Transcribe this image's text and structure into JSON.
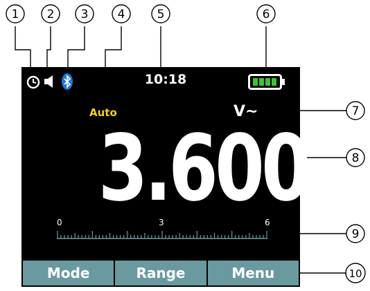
{
  "callouts": [
    "1",
    "2",
    "3",
    "4",
    "5",
    "6",
    "7",
    "8",
    "9",
    "10"
  ],
  "status_bar": {
    "time": "10:18",
    "battery_level": 1.0
  },
  "range_mode": "Auto",
  "unit": "V~",
  "reading": "3.600",
  "bargraph": {
    "scale_labels": [
      "0",
      "3",
      "6"
    ]
  },
  "softkeys": [
    "Mode",
    "Range",
    "Menu"
  ],
  "colors": {
    "auto": "#f2d21e",
    "bluetooth": "#1f78d1",
    "battery": "#3fbf3a",
    "softkey": "#6a9aa0"
  }
}
